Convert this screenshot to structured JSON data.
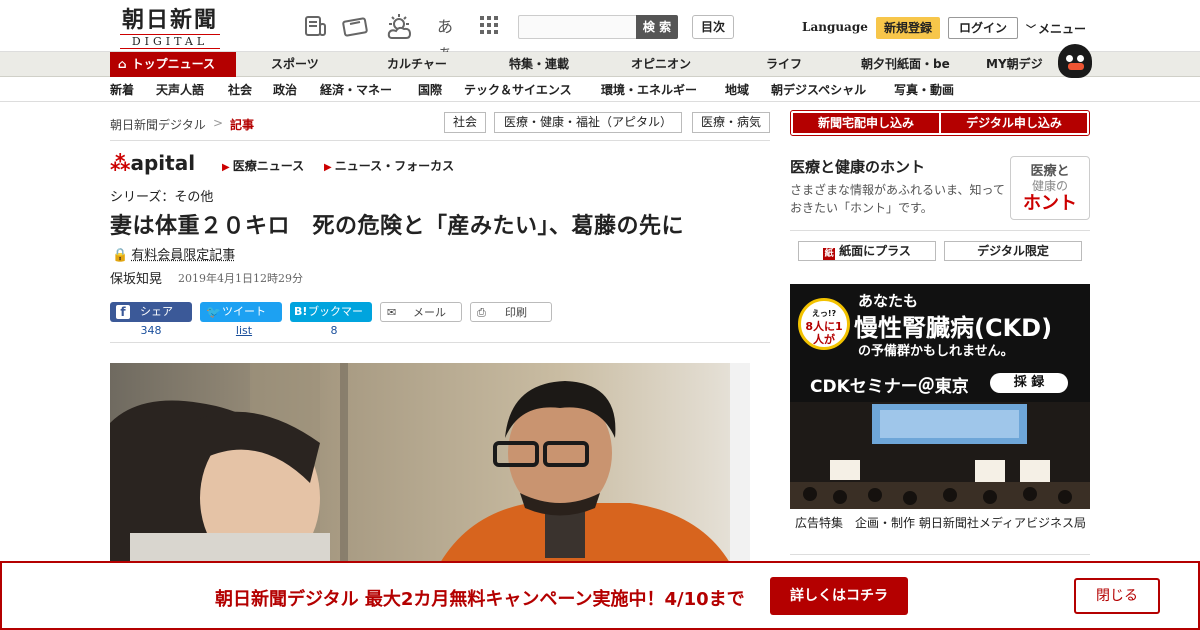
{
  "header": {
    "logo_jp": "朝日新聞",
    "logo_en": "DIGITAL",
    "aa_label": "あぁ",
    "search_button": "検 索",
    "mokuji": "目次",
    "language": "Language",
    "register": "新規登録",
    "login": "ログイン",
    "menu": "メニュー"
  },
  "nav_main": {
    "top": "トップニュース",
    "items": [
      "スポーツ",
      "カルチャー",
      "特集・連載",
      "オピニオン",
      "ライフ",
      "朝夕刊紙面・be",
      "MY朝デジ"
    ]
  },
  "nav_sub": {
    "items": [
      "新着",
      "天声人語",
      "社会",
      "政治",
      "経済・マネー",
      "国際",
      "テック＆サイエンス",
      "環境・エネルギー",
      "地域",
      "朝デジスペシャル",
      "写真・動画"
    ]
  },
  "breadcrumb": {
    "root": "朝日新聞デジタル",
    "sep": ">",
    "current": "記事"
  },
  "tags": [
    "社会",
    "医療・健康・福祉（アピタル）",
    "医療・病気"
  ],
  "apital": {
    "logo": "apital",
    "categories": [
      "医療ニュース",
      "ニュース・フォーカス"
    ]
  },
  "article": {
    "series": "シリーズ：その他",
    "title": "妻は体重２０キロ　死の危険と「産みたい」、葛藤の先に",
    "paid_label": "有料会員限定記事",
    "author": "保坂知晃",
    "date": "2019年4月1日12時29分"
  },
  "share": {
    "facebook": "シェア",
    "facebook_count": "348",
    "twitter": "ツイート",
    "twitter_count": "list",
    "hatena": "ブックマーク",
    "hatena_count": "8",
    "mail": "メール",
    "print": "印刷"
  },
  "sidebar": {
    "subscribe_paper": "新聞宅配申し込み",
    "subscribe_digital": "デジタル申し込み",
    "honto_heading": "医療と健康のホント",
    "honto_text": "さまざまな情報があふれるいま、知っておきたい「ホント」です。",
    "honto_badge_top": "医療と",
    "honto_badge_mid": "健康の",
    "honto_badge_bottom": "ホント",
    "plus_paper": "紙面にプラス",
    "digital_only": "デジタル限定",
    "ad_line1": "あなたも",
    "ad_line2": "慢性腎臓病(CKD)",
    "ad_line3": "の予備群かもしれません。",
    "ad_badge_top": "えっ!?",
    "ad_badge": "8人に1人が",
    "ad_seminar": "CDKセミナー＠東京",
    "ad_record": "採 録",
    "ad_note": "広告特集　企画・制作 朝日新聞社メディアビジネス局"
  },
  "bottom_banner": {
    "text": "朝日新聞デジタル 最大2カ月無料キャンペーン実施中！4/10まで",
    "button": "詳しくはコチラ",
    "close": "閉じる"
  },
  "colors": {
    "brand_red": "#b40000",
    "register_yellow": "#f7c64a",
    "facebook_blue": "#3b5998",
    "twitter_blue": "#1da1f2",
    "hatena_blue": "#00a4de"
  }
}
